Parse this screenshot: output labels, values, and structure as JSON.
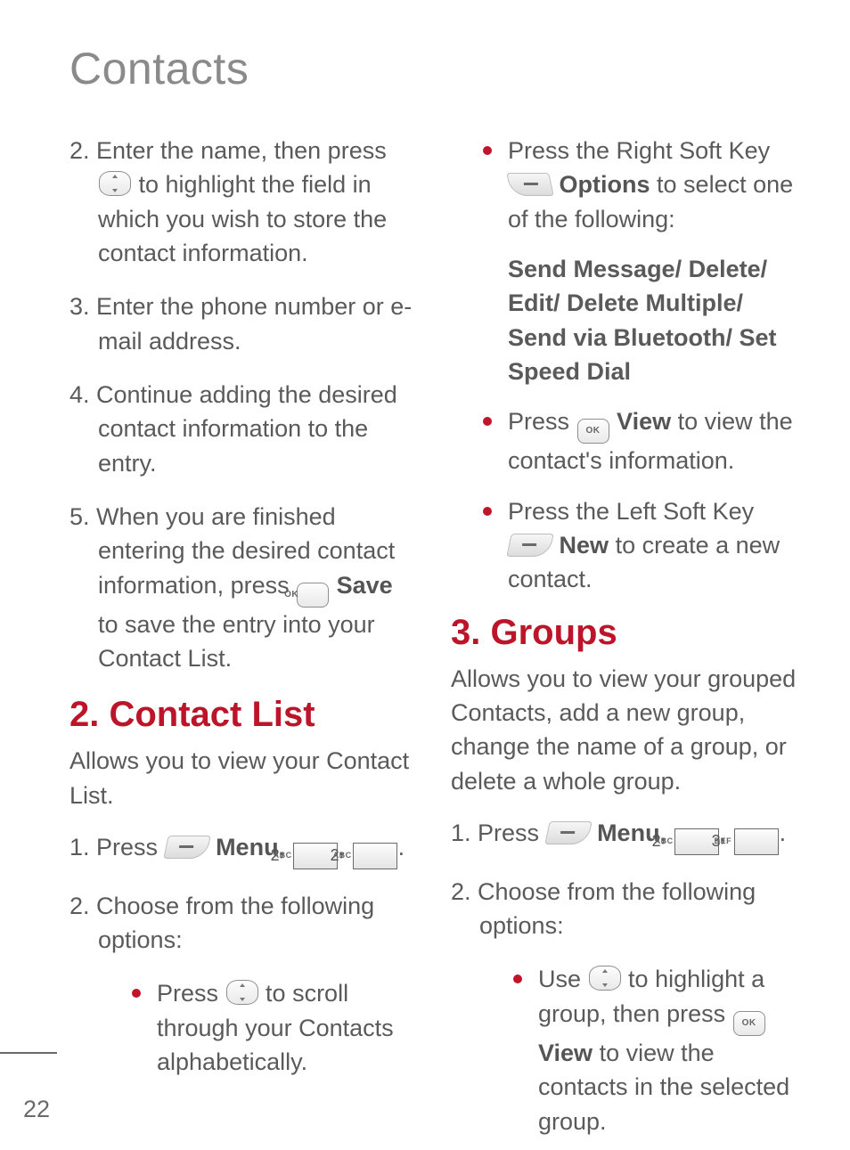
{
  "page": {
    "title": "Contacts",
    "number": "22"
  },
  "left": {
    "step2_a": "2. Enter the name, then press ",
    "step2_b": " to highlight the field in which you wish to store the contact information.",
    "step3": "3. Enter the phone number or e-mail address.",
    "step4": "4. Continue adding the desired contact information to the entry.",
    "step5_a": "5. When you are finished entering the desired contact information, press ",
    "step5_save": " Save",
    "step5_b": " to save the entry into your Contact List.",
    "h2": "2. Contact List",
    "para": "Allows you to view your Contact List.",
    "cl_step1_a": "1. Press ",
    "cl_step1_menu": " Menu",
    "cl_step1_comma": ", ",
    "cl_step1_end": ".",
    "cl_step2": "2. Choose from the following options:",
    "cl_b1_a": "Press ",
    "cl_b1_b": " to scroll through your Contacts alphabetically."
  },
  "right": {
    "b1_a": "Press the Right Soft Key ",
    "b1_opt": " Options",
    "b1_b": " to select one of the following:",
    "opts": "Send Message/ Delete/ Edit/ Delete Multiple/ Send via Bluetooth/ Set Speed Dial",
    "b2_a": "Press ",
    "b2_view": " View",
    "b2_b": " to view the contact's information.",
    "b3_a": "Press the Left Soft Key ",
    "b3_new": " New",
    "b3_b": " to create a new contact.",
    "h2": "3. Groups",
    "para": "Allows you to view your grouped Contacts, add a new group, change the name of a group, or delete a whole group.",
    "g_step1_a": "1. Press ",
    "g_step1_menu": " Menu",
    "g_step1_comma": ", ",
    "g_step1_end": ".",
    "g_step2": "2. Choose from the following options:",
    "g_b1_a": "Use ",
    "g_b1_b": " to highlight a group, then press ",
    "g_b1_view": "View",
    "g_b1_c": " to view the contacts in the selected group."
  },
  "keys": {
    "ok": "OK",
    "two": "2",
    "two_sub": "ABC",
    "three": "3",
    "three_sub": "DEF"
  }
}
